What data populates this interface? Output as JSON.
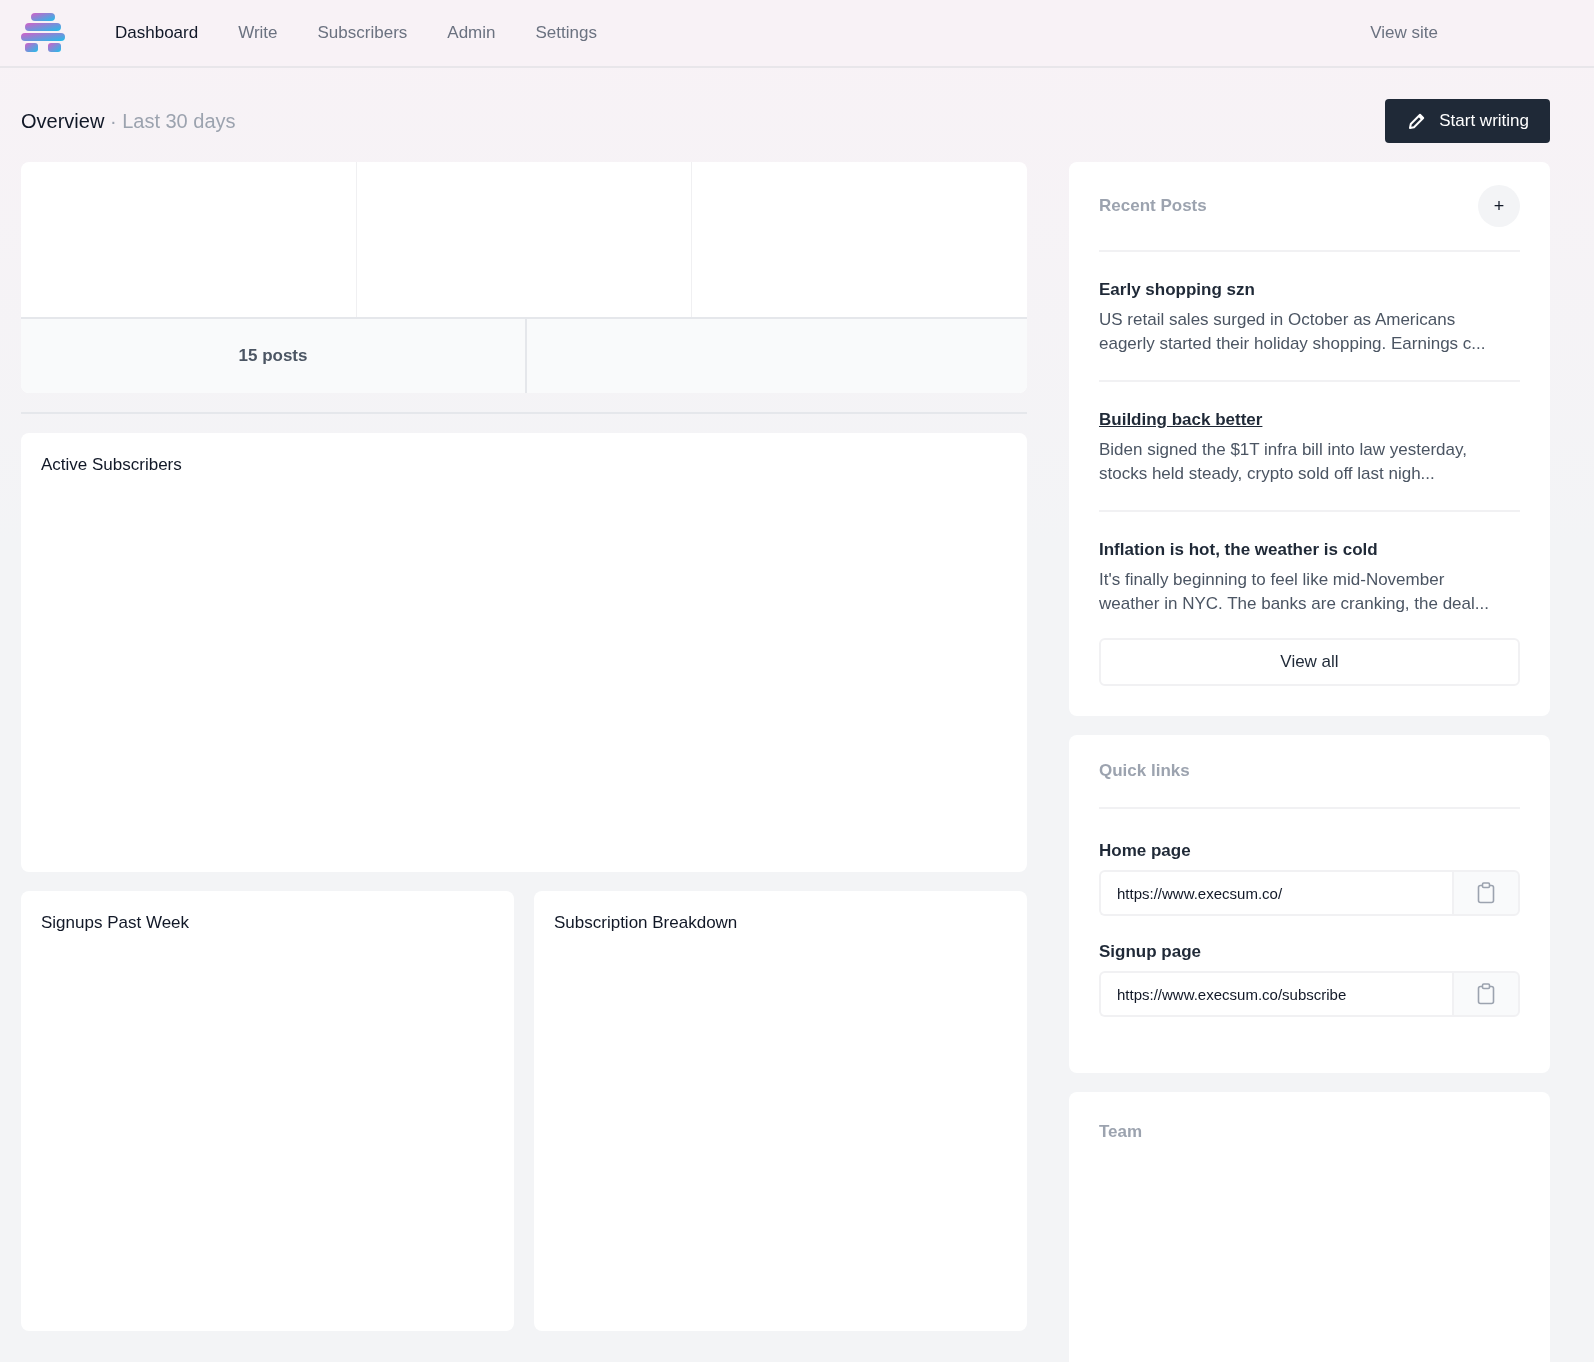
{
  "nav": {
    "tabs": [
      {
        "label": "Dashboard",
        "selected": true
      },
      {
        "label": "Write",
        "selected": false
      },
      {
        "label": "Subscribers",
        "selected": false
      },
      {
        "label": "Admin",
        "selected": false
      },
      {
        "label": "Settings",
        "selected": false
      }
    ],
    "view_site": "View site"
  },
  "overview": {
    "title": "Overview",
    "period": "· Last 30 days",
    "start_writing": "Start writing"
  },
  "stats": {
    "summary": "15 posts"
  },
  "charts": [
    {
      "title": "Active Subscribers"
    },
    {
      "title": "Signups Past Week"
    },
    {
      "title": "Subscription Breakdown"
    }
  ],
  "recent_posts": {
    "title": "Recent Posts",
    "add": "+",
    "posts": [
      {
        "title": "Early shopping szn",
        "excerpt": "US retail sales surged in October as Americans eagerly started their holiday shopping. Earnings c...",
        "hovered": false
      },
      {
        "title": "Building back better",
        "excerpt": "Biden signed the $1T infra bill into law yesterday, stocks held steady, crypto sold off last nigh...",
        "hovered": true
      },
      {
        "title": "Inflation is hot, the weather is cold",
        "excerpt": "It's finally beginning to feel like mid-November weather in NYC. The banks are cranking, the deal...",
        "hovered": false
      }
    ],
    "view_all": "View all"
  },
  "quick_links": {
    "title": "Quick links",
    "links": [
      {
        "label": "Home page",
        "value": "https://www.execsum.co/"
      },
      {
        "label": "Signup page",
        "value": "https://www.execsum.co/subscribe"
      }
    ]
  },
  "team": {
    "title": "Team"
  }
}
